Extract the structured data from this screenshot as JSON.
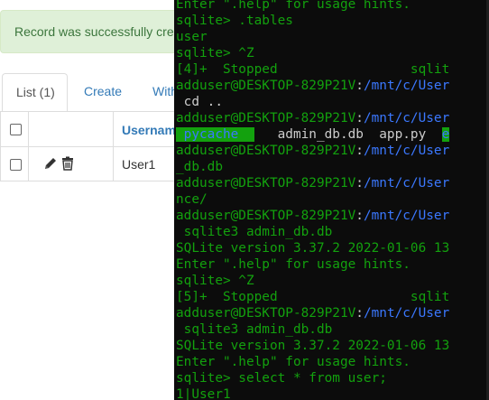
{
  "alert": {
    "text": "Record was successfully cre"
  },
  "tabs": [
    {
      "label": "List (1)"
    },
    {
      "label": "Create"
    },
    {
      "label": "With"
    }
  ],
  "table": {
    "columns": [
      "",
      "",
      "Username"
    ],
    "rows": [
      {
        "username": "User1"
      }
    ]
  },
  "icons": {
    "edit": "pencil-icon",
    "delete": "trash-icon"
  },
  "terminal": {
    "lines": [
      {
        "segments": [
          {
            "t": "Enter \".help\" for usage hints.",
            "c": "green"
          }
        ]
      },
      {
        "segments": [
          {
            "t": "sqlite> .tables",
            "c": "green"
          }
        ]
      },
      {
        "segments": [
          {
            "t": "user",
            "c": "green"
          }
        ]
      },
      {
        "segments": [
          {
            "t": "sqlite> ^Z",
            "c": "green"
          }
        ]
      },
      {
        "segments": [
          {
            "t": "[4]+  Stopped                 sqlit",
            "c": "green"
          }
        ]
      },
      {
        "segments": [
          {
            "t": "adduser@DESKTOP-829P21V",
            "c": "green"
          },
          {
            "t": ":",
            "c": "plain"
          },
          {
            "t": "/mnt/c/User",
            "c": "blue"
          }
        ]
      },
      {
        "segments": [
          {
            "t": " cd ..",
            "c": "plain"
          }
        ]
      },
      {
        "segments": [
          {
            "t": "adduser@DESKTOP-829P21V",
            "c": "green"
          },
          {
            "t": ":",
            "c": "plain"
          },
          {
            "t": "/mnt/c/User",
            "c": "blue"
          }
        ]
      },
      {
        "segments": [
          {
            "t": " pycache  ",
            "c": "hl"
          },
          {
            "t": "   admin_db.db  app.py  ",
            "c": "plain"
          },
          {
            "t": "e",
            "c": "hl"
          }
        ]
      },
      {
        "segments": [
          {
            "t": "adduser@DESKTOP-829P21V",
            "c": "green"
          },
          {
            "t": ":",
            "c": "plain"
          },
          {
            "t": "/mnt/c/User",
            "c": "blue"
          }
        ]
      },
      {
        "segments": [
          {
            "t": "_db.db",
            "c": "green"
          }
        ]
      },
      {
        "segments": [
          {
            "t": "adduser@DESKTOP-829P21V",
            "c": "green"
          },
          {
            "t": ":",
            "c": "plain"
          },
          {
            "t": "/mnt/c/User",
            "c": "blue"
          }
        ]
      },
      {
        "segments": [
          {
            "t": "nce/",
            "c": "green"
          }
        ]
      },
      {
        "segments": [
          {
            "t": "adduser@DESKTOP-829P21V",
            "c": "green"
          },
          {
            "t": ":",
            "c": "plain"
          },
          {
            "t": "/mnt/c/User",
            "c": "blue"
          }
        ]
      },
      {
        "segments": [
          {
            "t": " sqlite3 admin_db.db",
            "c": "green"
          }
        ]
      },
      {
        "segments": [
          {
            "t": "SQLite version 3.37.2 2022-01-06 13",
            "c": "green"
          }
        ]
      },
      {
        "segments": [
          {
            "t": "Enter \".help\" for usage hints.",
            "c": "green"
          }
        ]
      },
      {
        "segments": [
          {
            "t": "sqlite> ^Z",
            "c": "green"
          }
        ]
      },
      {
        "segments": [
          {
            "t": "[5]+  Stopped                 sqlit",
            "c": "green"
          }
        ]
      },
      {
        "segments": [
          {
            "t": "adduser@DESKTOP-829P21V",
            "c": "green"
          },
          {
            "t": ":",
            "c": "plain"
          },
          {
            "t": "/mnt/c/User",
            "c": "blue"
          }
        ]
      },
      {
        "segments": [
          {
            "t": " sqlite3 admin_db.db",
            "c": "green"
          }
        ]
      },
      {
        "segments": [
          {
            "t": "SQLite version 3.37.2 2022-01-06 13",
            "c": "green"
          }
        ]
      },
      {
        "segments": [
          {
            "t": "Enter \".help\" for usage hints.",
            "c": "green"
          }
        ]
      },
      {
        "segments": [
          {
            "t": "sqlite> select * from user;",
            "c": "green"
          }
        ]
      },
      {
        "segments": [
          {
            "t": "1|User1",
            "c": "green"
          }
        ]
      },
      {
        "segments": [
          {
            "t": "sqlite> ",
            "c": "green"
          },
          {
            "t": "",
            "c": "cursor"
          }
        ]
      }
    ]
  },
  "colors": {
    "terminal_bg": "#0c0c0c",
    "terminal_green": "#13a10e",
    "terminal_blue": "#3b78ff",
    "alert_bg": "#dff0d8",
    "link": "#337ab7"
  }
}
